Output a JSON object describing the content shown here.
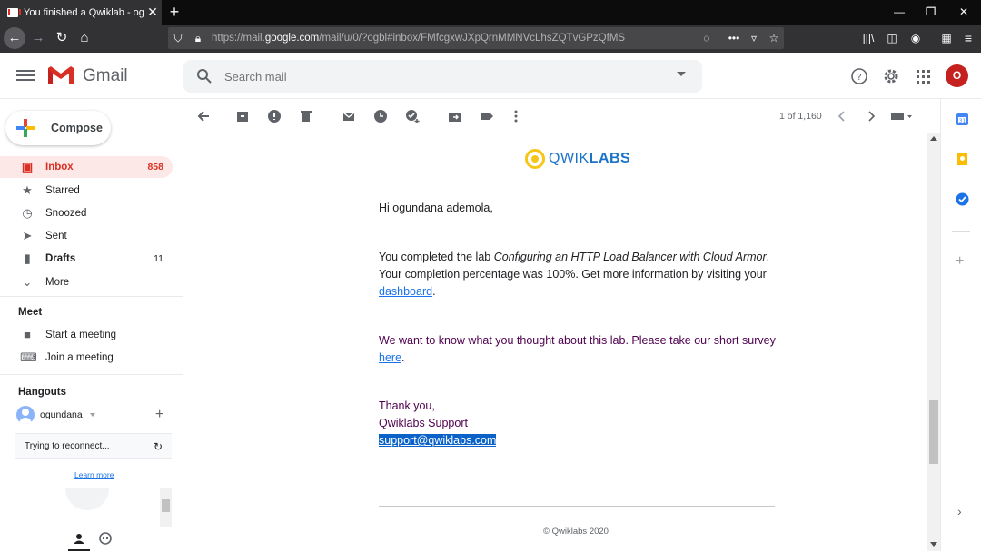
{
  "browser": {
    "tab_title": "You finished a Qwiklab - ogund",
    "url_prefix": "https://mail.",
    "url_domain": "google.com",
    "url_path": "/mail/u/0/?ogbl#inbox/FMfcgxwJXpQrnMMNVcLhsZQTvGPzQfMS"
  },
  "gmail": {
    "brand": "Gmail",
    "search_placeholder": "Search mail",
    "avatar_letter": "O"
  },
  "sidebar": {
    "compose_label": "Compose",
    "items": [
      {
        "label": "Inbox",
        "count": "858"
      },
      {
        "label": "Starred",
        "count": ""
      },
      {
        "label": "Snoozed",
        "count": ""
      },
      {
        "label": "Sent",
        "count": ""
      },
      {
        "label": "Drafts",
        "count": "11"
      },
      {
        "label": "More",
        "count": ""
      }
    ],
    "meet_heading": "Meet",
    "meet_items": [
      "Start a meeting",
      "Join a meeting"
    ],
    "hangouts_heading": "Hangouts",
    "hangouts_user": "ogundana",
    "reconnect_text": "Trying to reconnect...",
    "learn_more": "Learn more"
  },
  "toolbar": {
    "pager": "1 of 1,160"
  },
  "email": {
    "logo_part1": "QWIK",
    "logo_part2": "LABS",
    "greeting": "Hi ogundana ademola,",
    "p1_before": "You completed the lab ",
    "p1_lab": "Configuring an HTTP Load Balancer with Cloud Armor",
    "p1_after": ". Your completion percentage was 100%. Get more information by visiting your ",
    "p1_link": "dashboard",
    "p1_end": ".",
    "p2_before": "We want to know what you thought about this lab. Please take our short survey ",
    "p2_link": "here",
    "p2_end": ".",
    "thanks": "Thank you,",
    "signature": "Qwiklabs Support",
    "support_email": "support@qwiklabs.com",
    "footer": "© Qwiklabs 2020"
  },
  "colors": {
    "inbox_accent": "#d93025",
    "link": "#1a73e8",
    "avatar_bg": "#c5221f",
    "qwiklabs_yellow": "#f5c518",
    "qwiklabs_blue": "#1a73c8"
  }
}
